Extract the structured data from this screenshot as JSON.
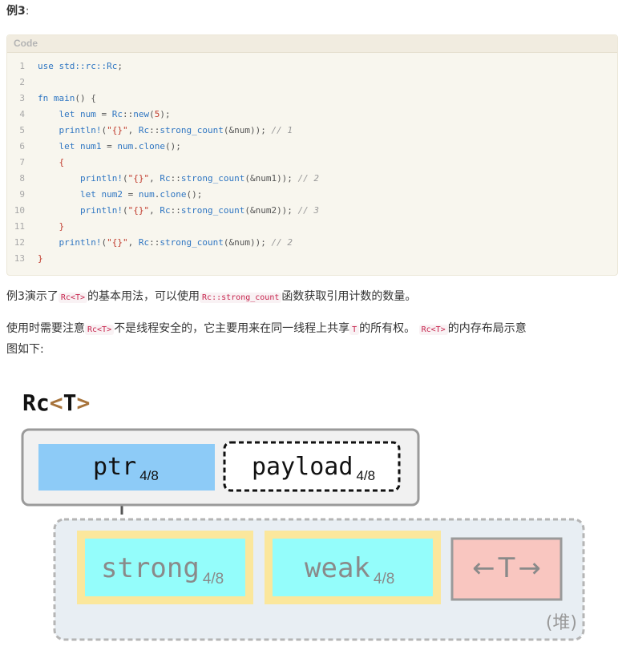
{
  "heading": {
    "prefix": "例3",
    "colon": ":"
  },
  "code_block": {
    "label": "Code",
    "lines": [
      {
        "n": "1"
      },
      {
        "n": "2"
      },
      {
        "n": "3"
      },
      {
        "n": "4"
      },
      {
        "n": "5"
      },
      {
        "n": "6"
      },
      {
        "n": "7"
      },
      {
        "n": "8"
      },
      {
        "n": "9"
      },
      {
        "n": "10"
      },
      {
        "n": "11"
      },
      {
        "n": "12"
      },
      {
        "n": "13"
      }
    ],
    "t": {
      "use": "use",
      "path": "std::rc::Rc",
      "semi": ";",
      "fn": "fn",
      "main": "main",
      "main_rest": "() {",
      "let": "let",
      "num": "num",
      "eq": " = ",
      "rc": "Rc",
      "colons": "::",
      "new": "new",
      "five_open": "(",
      "five": "5",
      "five_close": ");",
      "println": "println!",
      "open": "(",
      "fmt": "\"{}\"",
      "comma": ", ",
      "sc": "strong_count",
      "refnum": "(&num));",
      "c1": "// 1",
      "num1": "num1",
      "dot": ".",
      "clone": "clone",
      "clone_rest": "();",
      "lbrace": "{",
      "refnum1": "(&num1));",
      "c2": "// 2",
      "num2": "num2",
      "refnum2": "(&num2));",
      "c3": "// 3",
      "rbrace": "}"
    }
  },
  "para1": {
    "a": "例3演示了",
    "code1": "Rc<T>",
    "b": "的基本用法，可以使用",
    "code2": "Rc::strong_count",
    "c": "函数获取引用计数的数量。"
  },
  "para2": {
    "a": "使用时需要注意",
    "code1": "Rc<T>",
    "b": "不是线程安全的，它主要用来在同一线程上共享",
    "code2": "T",
    "c": "的所有权。",
    "code3": "Rc<T>",
    "d": "的内存布局示意",
    "e": "图如下:"
  },
  "diagram": {
    "title_rc": "Rc",
    "title_lt": "<",
    "title_t": "T",
    "title_gt": ">",
    "ptr": "ptr",
    "ptr_sub": "4/8",
    "payload": "payload",
    "payload_sub": "4/8",
    "strong": "strong",
    "strong_sub": "4/8",
    "weak": "weak",
    "weak_sub": "4/8",
    "t_left": "←",
    "t": "T",
    "t_right": "→",
    "heap": "(堆)",
    "colors": {
      "ptr_fill": "#8dcbf7",
      "counter_fill": "#94fdfb",
      "counter_border": "#fbe79c",
      "t_fill": "#f9c6c0",
      "heap_fill": "#e8eef3",
      "outer_fill": "#f1f1f1",
      "angle": "#a7733b"
    }
  }
}
